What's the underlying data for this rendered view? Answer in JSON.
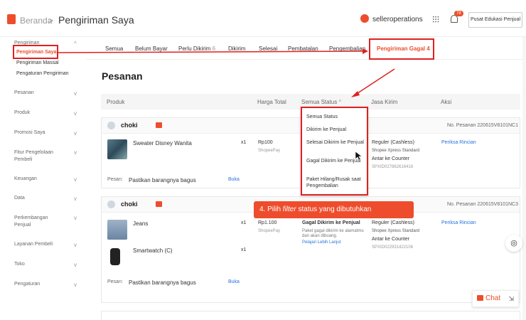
{
  "header": {
    "brand": "Beranda",
    "separator": ">",
    "title": "Pengiriman Saya",
    "username": "selleroperations",
    "notification_count": "78",
    "edu_button": "Pusat Edukasi Penjual"
  },
  "sidebar": {
    "groups": [
      {
        "label": "Pengiriman",
        "chevron": "^"
      },
      {
        "label": "Pesanan",
        "chevron": "v"
      },
      {
        "label": "Produk",
        "chevron": "v"
      },
      {
        "label": "Promosi Saya",
        "chevron": "v"
      },
      {
        "label": "Fitur Pengelolaan Pembeli",
        "chevron": "v"
      },
      {
        "label": "Keuangan",
        "chevron": "v"
      },
      {
        "label": "Data",
        "chevron": "v"
      },
      {
        "label": "Perkembangan Penjual",
        "chevron": "v"
      },
      {
        "label": "Layanan Pembeli",
        "chevron": "v"
      },
      {
        "label": "Toko",
        "chevron": "v"
      },
      {
        "label": "Pengaturan",
        "chevron": "v"
      }
    ],
    "subitems": [
      "Pengiriman Saya",
      "Pengiriman Massal",
      "Pengaturan Pengiriman"
    ]
  },
  "tabs": [
    {
      "label": "Semua",
      "count": ""
    },
    {
      "label": "Belum Bayar",
      "count": ""
    },
    {
      "label": "Perlu Dikirim",
      "count": "6"
    },
    {
      "label": "Dikirim",
      "count": ""
    },
    {
      "label": "Selesai",
      "count": ""
    },
    {
      "label": "Pembatalan",
      "count": ""
    },
    {
      "label": "Pengembalian",
      "count": ""
    },
    {
      "label": "Pengiriman Gagal",
      "count": "4"
    }
  ],
  "section_title": "Pesanan",
  "table_headers": {
    "product": "Produk",
    "total": "Harga Total",
    "status": "Semua Status",
    "courier": "Jasa Kirim",
    "action": "Aksi"
  },
  "status_dropdown": [
    "Semua Status",
    "Dikirim ke Penjual",
    "Selesai Dikirim ke Penjual",
    "Gagal Dikirim ke Penjual",
    "Paket Hilang/Rusak saat Pengembalian"
  ],
  "orders": [
    {
      "buyer": "choki",
      "order_no": "No. Pesanan 220615V8101NC1",
      "items": [
        {
          "name": "Sweater Disney Wanita",
          "qty": "x1"
        }
      ],
      "price": "Rp100",
      "payment": "ShopeePay",
      "courier": "Reguler (Cashless)",
      "courier_sub": "Shopee Xpress Standard",
      "courier_method": "Antar ke Counter",
      "tracking": "SPXID027862616416",
      "action": "Periksa Rincian",
      "note_label": "Pesan:",
      "note": "Pastikan barangnya bagus",
      "note_link": "Buka"
    },
    {
      "buyer": "choki",
      "order_no": "No. Pesanan 220615V8101NC3",
      "items": [
        {
          "name": "Jeans",
          "qty": "x1"
        },
        {
          "name": "Smartwatch (C)",
          "qty": "x1"
        }
      ],
      "price": "Rp1.100",
      "payment": "ShopeePay",
      "status": "Gagal Dikirim ke Penjual",
      "status_desc": "Paket gagal dikirim ke alamatmu dan akan dibuang.",
      "status_link": "Pelajari Lebih Lanjut",
      "courier": "Reguler (Cashless)",
      "courier_sub": "Shopee Xpress Standard",
      "courier_method": "Antar ke Counter",
      "tracking": "SPXID022931422106",
      "action": "Periksa Rincian",
      "note_label": "Pesan:",
      "note": "Pastikan barangnya bagus",
      "note_link": "Buka"
    }
  ],
  "callout": {
    "prefix": "4. Pilih ",
    "emphasis": "filter",
    "suffix": " status yang dibutuhkan"
  },
  "chat_button": "Chat",
  "colors": {
    "accent": "#ee4d2d",
    "annotation": "#e02020",
    "link": "#2673dd"
  }
}
